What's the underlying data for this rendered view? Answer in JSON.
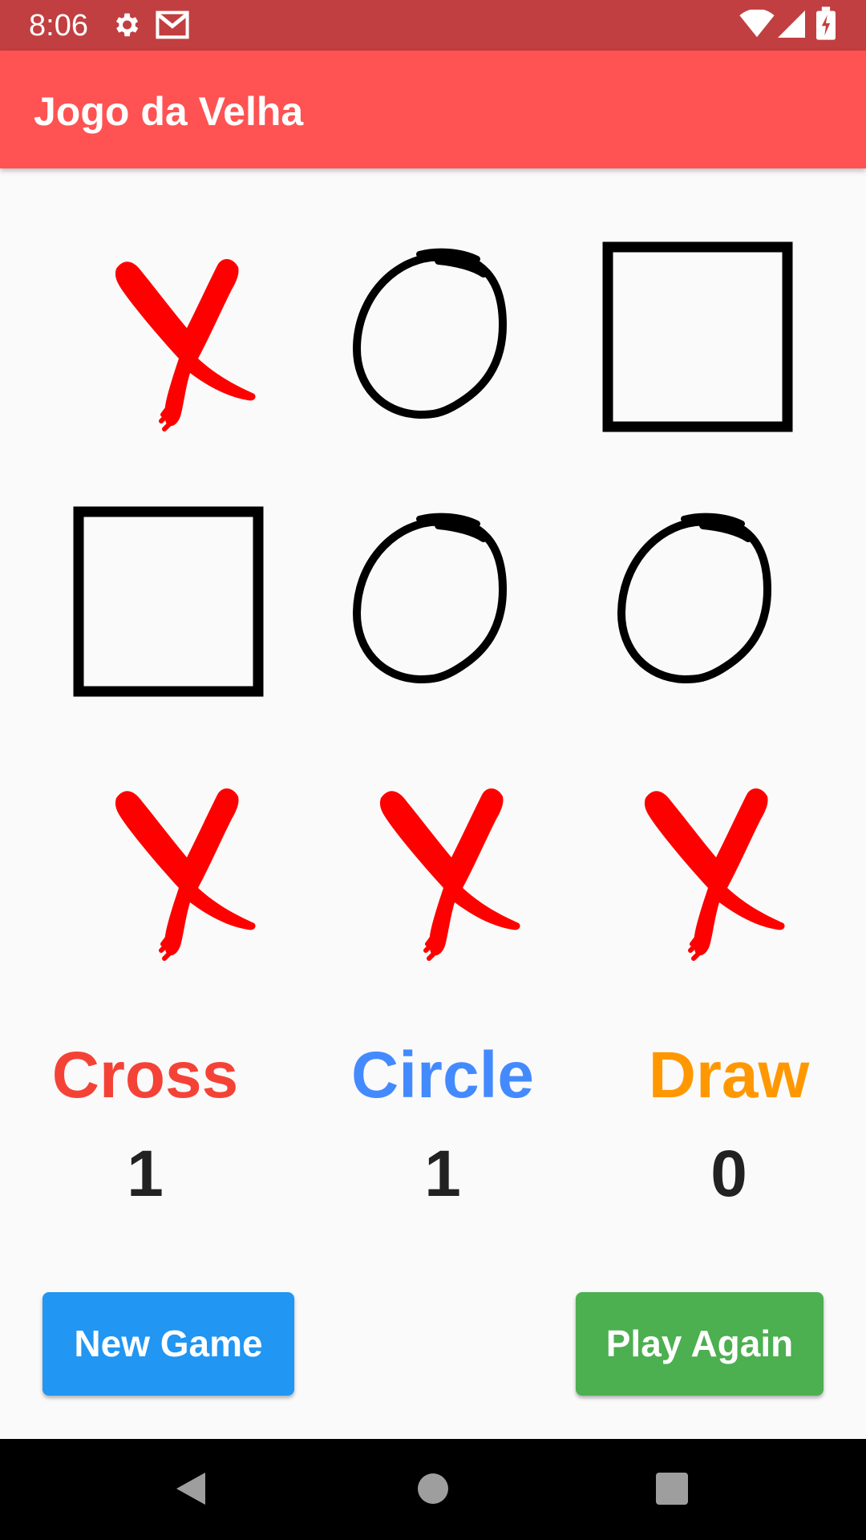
{
  "status_bar": {
    "time": "8:06",
    "icons": [
      "gear-icon",
      "gmail-icon",
      "wifi-icon",
      "signal-icon",
      "battery-charging-icon"
    ]
  },
  "app_bar": {
    "title": "Jogo da Velha"
  },
  "board": {
    "cells": [
      "X",
      "O",
      "empty",
      "empty",
      "O",
      "O",
      "X",
      "X",
      "X"
    ]
  },
  "scores": {
    "cross": {
      "label": "Cross",
      "value": "1",
      "color": "#f44336"
    },
    "circle": {
      "label": "Circle",
      "value": "1",
      "color": "#448aff"
    },
    "draw": {
      "label": "Draw",
      "value": "0",
      "color": "#ff9800"
    }
  },
  "buttons": {
    "new_game": {
      "label": "New Game",
      "color": "#2196f3"
    },
    "play_again": {
      "label": "Play Again",
      "color": "#4caf50"
    }
  },
  "nav_bar": {
    "icons": [
      "back-icon",
      "home-icon",
      "recents-icon"
    ]
  }
}
